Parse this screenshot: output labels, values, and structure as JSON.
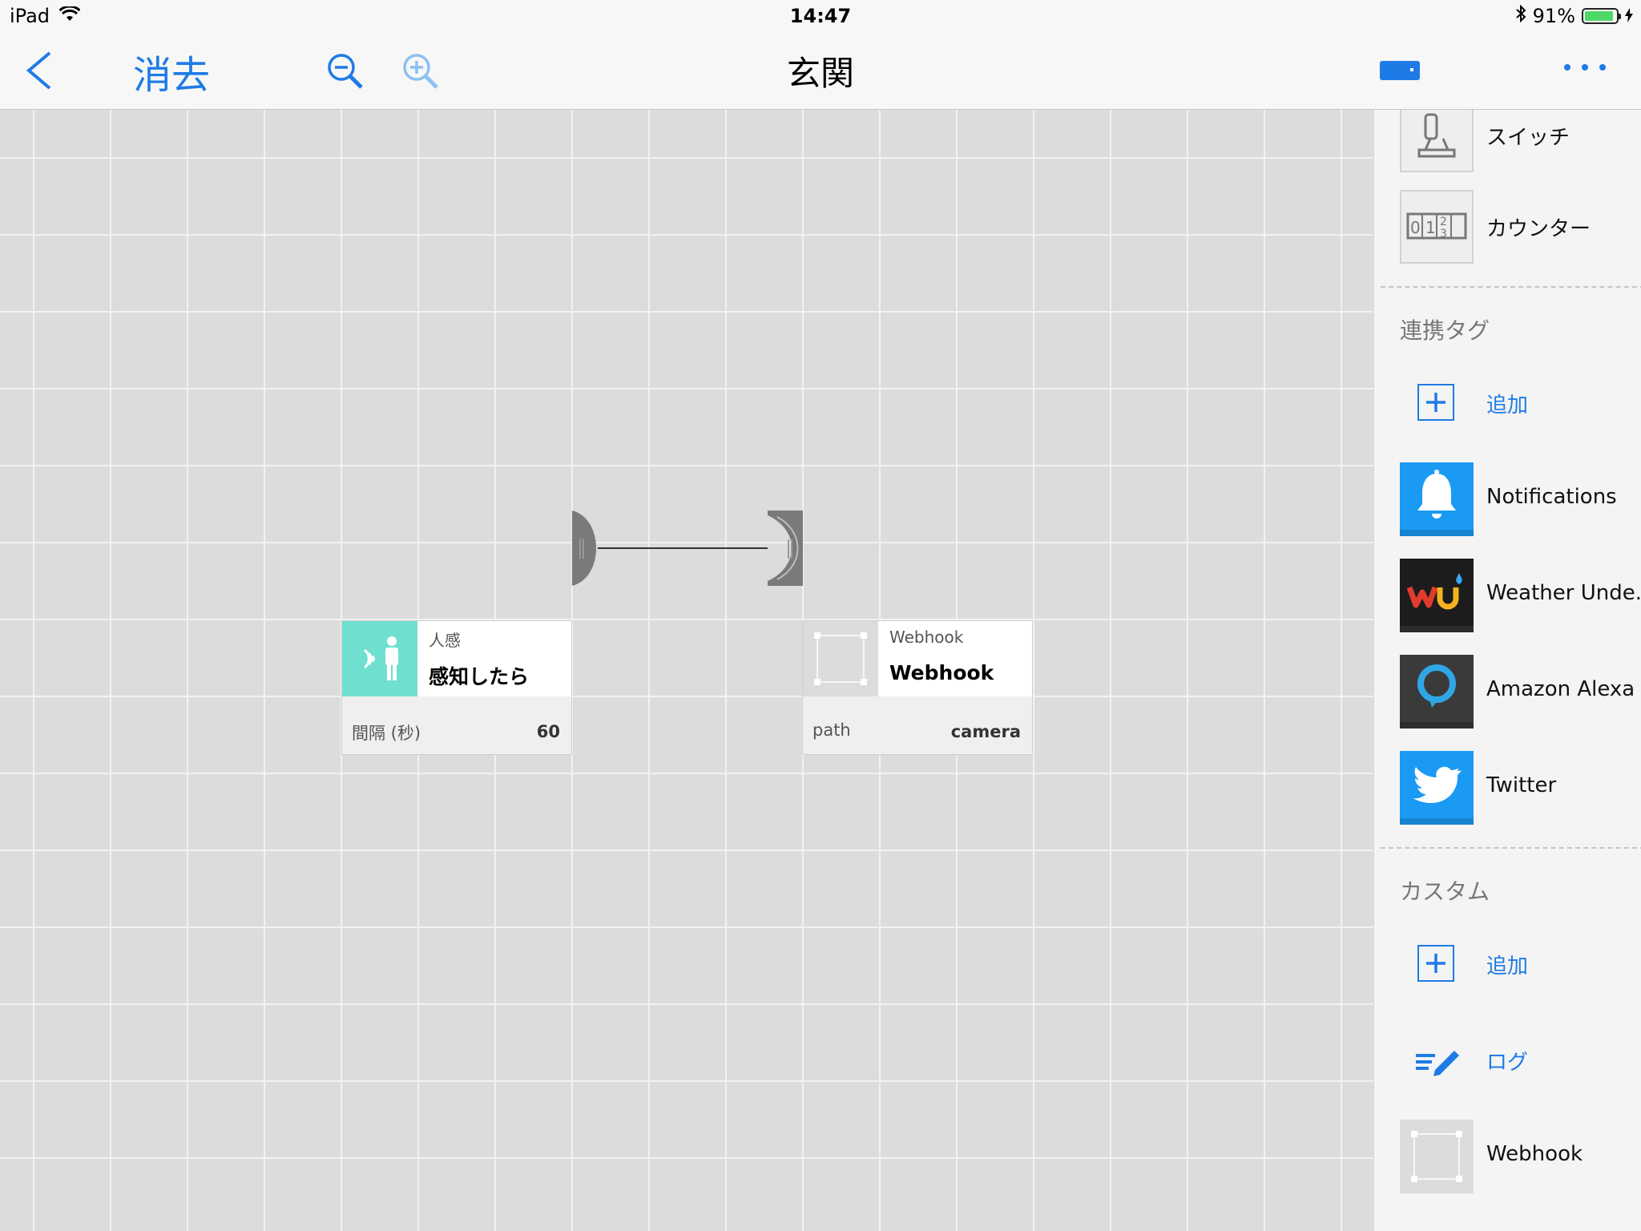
{
  "status_bar": {
    "device": "iPad",
    "time": "14:47",
    "battery_percent": "91%",
    "battery_level": 0.91
  },
  "navbar": {
    "clear_label": "消去",
    "title": "玄関",
    "icons": [
      "back-chevron-icon",
      "zoom-out-icon",
      "zoom-in-icon",
      "device-icon",
      "more-icon"
    ]
  },
  "canvas": {
    "nodes": [
      {
        "category": "人感",
        "name": "感知したら",
        "param_label": "間隔 (秒)",
        "param_value": "60",
        "icon": "motion-sensor-icon",
        "icon_bg": "#6fe0cf"
      },
      {
        "category": "Webhook",
        "name": "Webhook",
        "param_label": "path",
        "param_value": "camera",
        "icon": "webhook-icon",
        "icon_bg": "#dcdcdc"
      }
    ]
  },
  "sidebar": {
    "items_top": [
      {
        "label": "スイッチ",
        "icon": "switch-icon"
      },
      {
        "label": "カウンター",
        "icon": "counter-icon",
        "digits": [
          "0",
          "1",
          "2",
          "3"
        ]
      }
    ],
    "section_linked": {
      "title": "連携タグ",
      "add_label": "追加",
      "items": [
        {
          "label": "Notifications",
          "icon": "bell-icon",
          "bg": "#1a9af2"
        },
        {
          "label": "Weather Unde...",
          "icon": "weather-underground-icon",
          "bg": "#1c1c1c"
        },
        {
          "label": "Amazon Alexa",
          "icon": "alexa-icon",
          "bg": "#3a3a3a"
        },
        {
          "label": "Twitter",
          "icon": "twitter-bird-icon",
          "bg": "#1a9af2"
        }
      ]
    },
    "section_custom": {
      "title": "カスタム",
      "add_label": "追加",
      "items": [
        {
          "label": "ログ",
          "icon": "log-pencil-icon"
        },
        {
          "label": "Webhook",
          "icon": "webhook-icon"
        }
      ]
    }
  },
  "colors": {
    "accent": "#1e7be6",
    "motion_teal": "#6fe0cf",
    "canvas_bg": "#dcdcdc"
  }
}
